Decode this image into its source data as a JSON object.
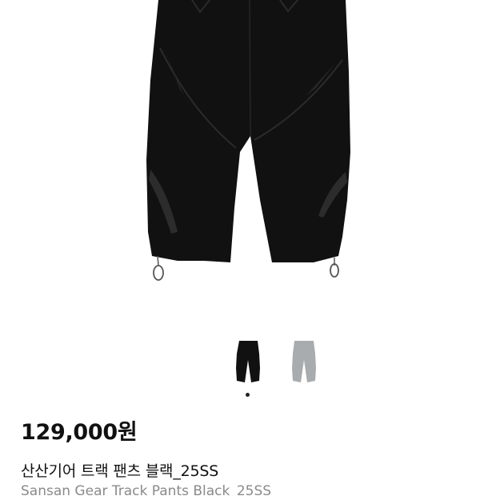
{
  "product": {
    "price": "129,000원",
    "title_ko": "산산기어 트랙 팬츠 블랙_25SS",
    "title_en": "Sansan Gear Track Pants Black_25SS",
    "main_image_icon": "black-track-pants-illustration",
    "color_options": [
      {
        "icon": "black-pants-thumbnail",
        "color": "#111111",
        "selected": true
      },
      {
        "icon": "grey-pants-thumbnail",
        "color": "#a9acae",
        "selected": false
      }
    ],
    "image_pagination": {
      "current": 1,
      "total": 1
    }
  },
  "colors": {
    "price_text": "#111111",
    "subtitle_text": "#8a8a8a",
    "pants_black": "#111111",
    "pants_grey": "#a9acae"
  }
}
